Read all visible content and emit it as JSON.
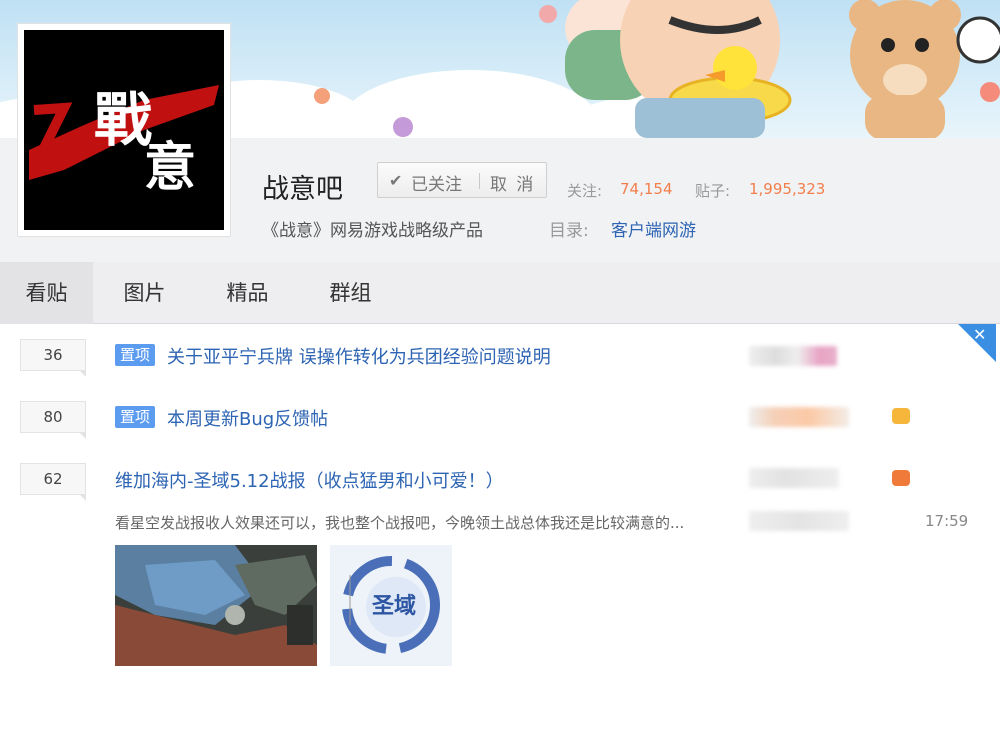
{
  "forum": {
    "name": "战意吧",
    "slogan": "《战意》网易游戏战略级产品",
    "logo_text": "戰意",
    "follow_label": "已关注",
    "cancel_label": "取 消",
    "followers_label": "关注:",
    "followers_value": "74,154",
    "posts_label": "贴子:",
    "posts_value": "1,995,323",
    "directory_label": "目录:",
    "directory_value": "客户端网游"
  },
  "tabs": [
    {
      "label": "看贴",
      "active": true
    },
    {
      "label": "图片",
      "active": false
    },
    {
      "label": "精品",
      "active": false
    },
    {
      "label": "群组",
      "active": false
    }
  ],
  "threads": [
    {
      "replies": "36",
      "pinned_label": "置项",
      "title": "关于亚平宁兵牌 误操作转化为兵团经验问题说明"
    },
    {
      "replies": "80",
      "pinned_label": "置项",
      "title": "本周更新Bug反馈帖"
    },
    {
      "replies": "62",
      "title": "维加海内-圣域5.12战报（收点猛男和小可爱！）",
      "excerpt": "看星空发战报收人效果还可以，我也整个战报吧，今晚领土战总体我还是比较满意的...",
      "time": "17:59",
      "thumb2_text": "圣域"
    }
  ],
  "colors": {
    "accent": "#2d64b3",
    "stat": "#f37e4b",
    "pin": "#5b9bf0",
    "corner": "#3b8fe3"
  }
}
